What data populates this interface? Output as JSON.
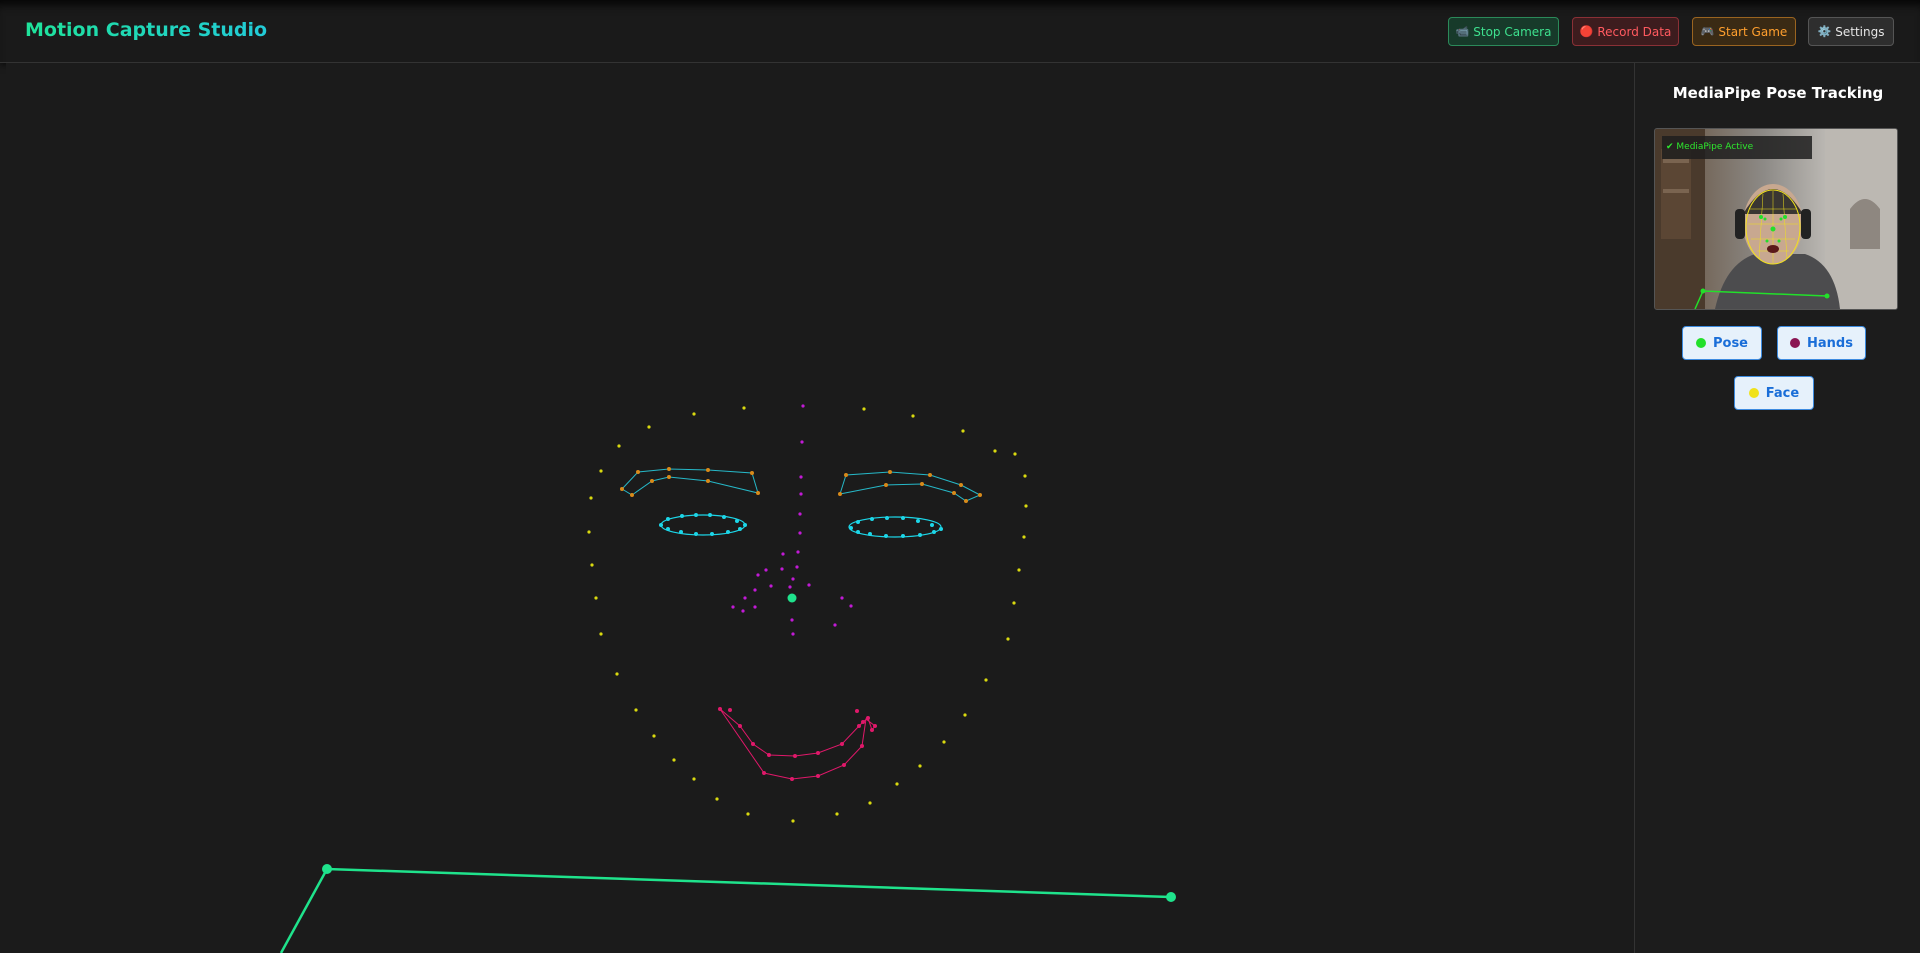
{
  "app": {
    "title": "Motion Capture Studio"
  },
  "toolbar": {
    "stop_camera": {
      "icon": "📹",
      "label": "Stop Camera"
    },
    "record_data": {
      "icon": "🔴",
      "label": "Record Data"
    },
    "start_game": {
      "icon": "🎮",
      "label": "Start Game"
    },
    "settings": {
      "icon": "⚙️",
      "label": "Settings"
    }
  },
  "panel": {
    "title": "MediaPipe Pose Tracking",
    "camera_status": "✔ MediaPipe Active",
    "toggles": [
      {
        "label": "Pose",
        "color": "#22e02a"
      },
      {
        "label": "Hands",
        "color": "#8a1552"
      },
      {
        "label": "Face",
        "color": "#f0e21a"
      }
    ]
  },
  "colors": {
    "face_contour": "#d9d90f",
    "eyebrows": "#d88a1a",
    "eyebrow_lines": "#26b8c8",
    "eyes": "#1cd6e8",
    "nose": "#c21ad6",
    "mouth": "#e0186a",
    "pose": "#1fe38c"
  }
}
